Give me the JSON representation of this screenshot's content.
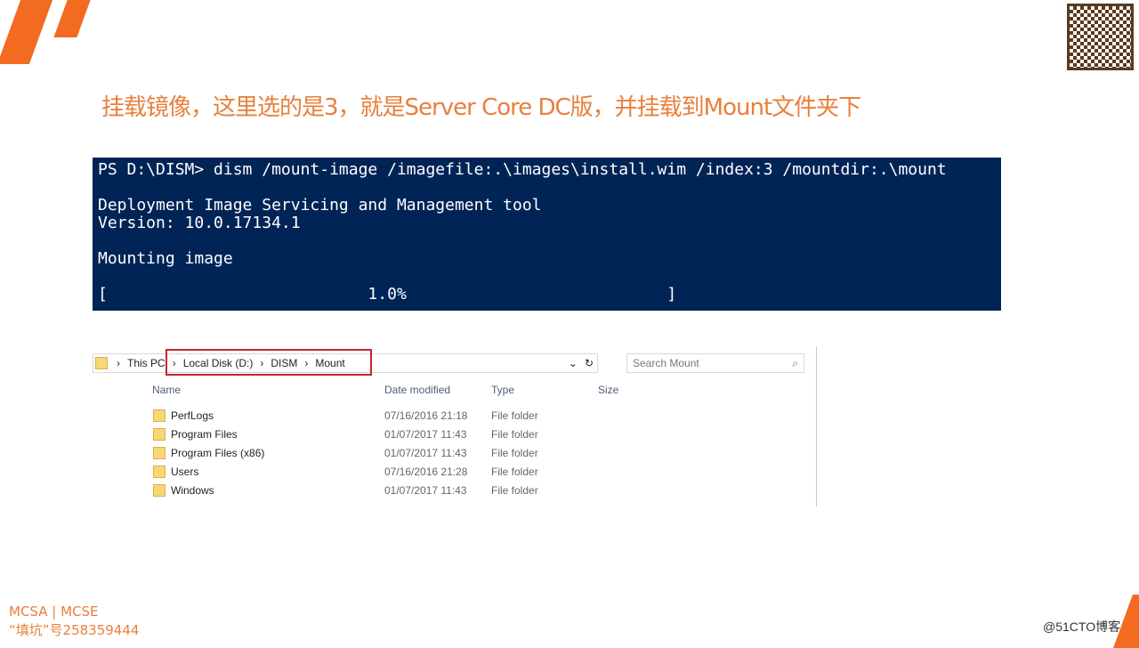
{
  "title": "挂载镜像，这里选的是3，就是Server Core DC版，并挂载到Mount文件夹下",
  "terminal": {
    "lines": [
      "PS D:\\DISM> dism /mount-image /imagefile:.\\images\\install.wim /index:3 /mountdir:.\\mount",
      "",
      "Deployment Image Servicing and Management tool",
      "Version: 10.0.17134.1",
      "",
      "Mounting image",
      "",
      "[                           1.0%                           ]"
    ]
  },
  "explorer": {
    "breadcrumb": [
      "This PC",
      "Local Disk (D:)",
      "DISM",
      "Mount"
    ],
    "search_placeholder": "Search Mount",
    "columns": [
      "Name",
      "Date modified",
      "Type",
      "Size"
    ],
    "rows": [
      {
        "name": "PerfLogs",
        "date": "07/16/2016 21:18",
        "type": "File folder"
      },
      {
        "name": "Program Files",
        "date": "01/07/2017 11:43",
        "type": "File folder"
      },
      {
        "name": "Program Files (x86)",
        "date": "01/07/2017 11:43",
        "type": "File folder"
      },
      {
        "name": "Users",
        "date": "07/16/2016 21:28",
        "type": "File folder"
      },
      {
        "name": "Windows",
        "date": "01/07/2017 11:43",
        "type": "File folder"
      }
    ]
  },
  "footer": {
    "line1": "MCSA | MCSE",
    "line2": "“填坑”号258359444",
    "watermark": "@51CTO博客"
  },
  "colors": {
    "accent": "#f26b21",
    "terminal_bg": "#012456",
    "highlight": "#c8262c"
  }
}
